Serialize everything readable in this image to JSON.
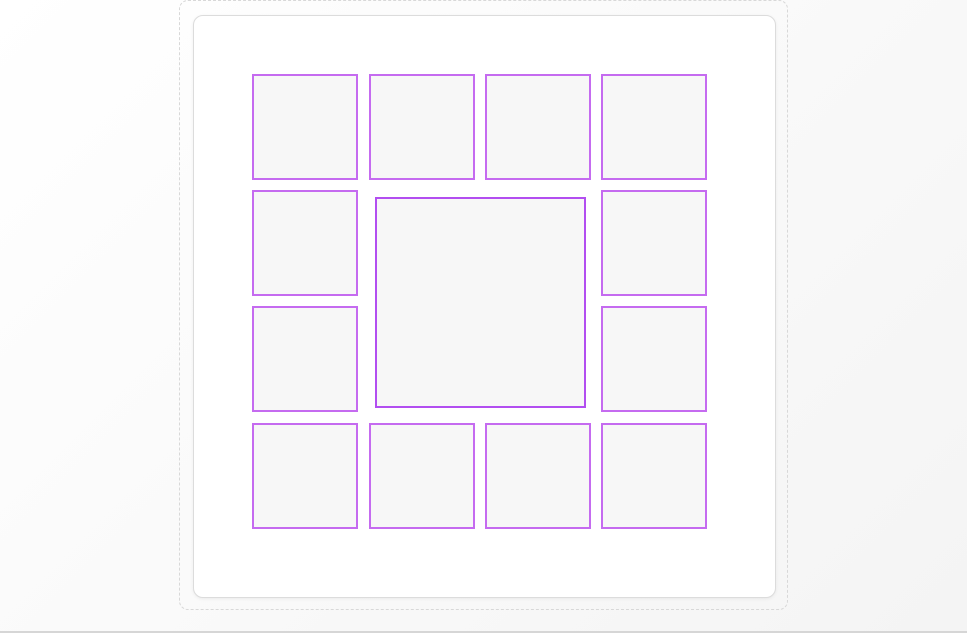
{
  "colors": {
    "tile_border": "#c56bf0",
    "center_border": "#b24ef0",
    "tile_fill": "#f7f7f7"
  },
  "grid": {
    "tile_count": 13
  }
}
